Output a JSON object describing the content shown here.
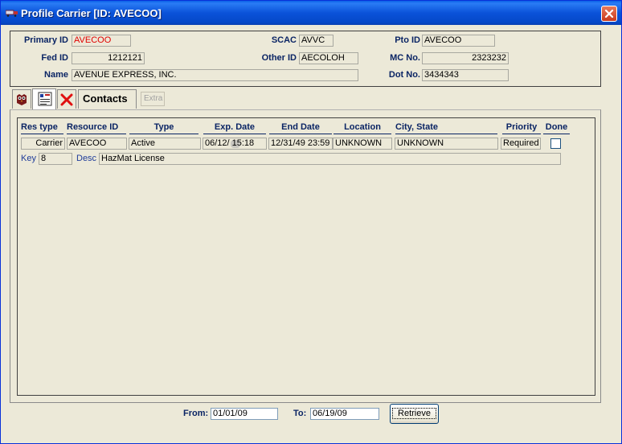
{
  "window": {
    "title": "Profile Carrier  [ID: AVECOO]"
  },
  "header": {
    "primary_id_label": "Primary ID",
    "primary_id_value": "AVECOO",
    "scac_label": "SCAC",
    "scac_value": "AVVC",
    "pto_id_label": "Pto ID",
    "pto_id_value": "AVECOO",
    "fed_id_label": "Fed ID",
    "fed_id_value": "1212121",
    "other_id_label": "Other ID",
    "other_id_value": "AECOLOH",
    "mc_no_label": "MC No.",
    "mc_no_value": "2323232",
    "name_label": "Name",
    "name_value": "AVENUE EXPRESS, INC.",
    "dot_no_label": "Dot No.",
    "dot_no_value": "3434343"
  },
  "tabs": {
    "contacts_label": "Contacts",
    "extra_label": "Extra"
  },
  "grid": {
    "columns": [
      "Res type",
      "Resource ID",
      "Type",
      "Exp. Date",
      "End Date",
      "Location",
      "City, State",
      "Priority",
      "Done"
    ],
    "row": {
      "res_type": "Carrier",
      "resource_id": "AVECOO",
      "type": "Active",
      "exp_date": "06/12/   15:18",
      "end_date": "12/31/49 23:59",
      "location": "UNKNOWN",
      "city_state": "UNKNOWN",
      "priority": "Required",
      "done": false,
      "key_label": "Key",
      "key_value": "8",
      "desc_label": "Desc",
      "desc_value": "HazMat License"
    }
  },
  "footer": {
    "from_label": "From:",
    "from_value": "01/01/09",
    "to_label": "To:",
    "to_value": "06/19/09",
    "retrieve_label": "Retrieve"
  }
}
